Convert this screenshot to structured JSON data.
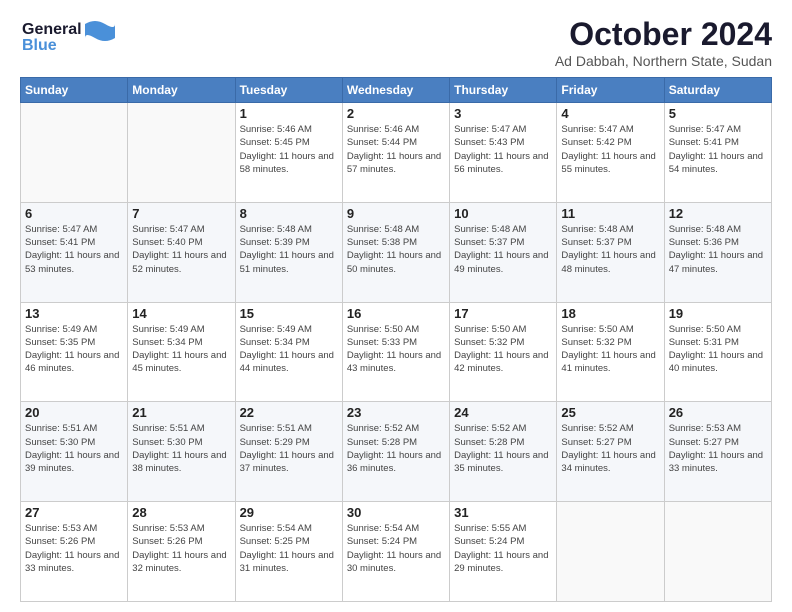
{
  "header": {
    "logo_line1": "General",
    "logo_line2": "Blue",
    "title": "October 2024",
    "subtitle": "Ad Dabbah, Northern State, Sudan"
  },
  "days_of_week": [
    "Sunday",
    "Monday",
    "Tuesday",
    "Wednesday",
    "Thursday",
    "Friday",
    "Saturday"
  ],
  "weeks": [
    [
      {
        "day": "",
        "info": ""
      },
      {
        "day": "",
        "info": ""
      },
      {
        "day": "1",
        "info": "Sunrise: 5:46 AM\nSunset: 5:45 PM\nDaylight: 11 hours and 58 minutes."
      },
      {
        "day": "2",
        "info": "Sunrise: 5:46 AM\nSunset: 5:44 PM\nDaylight: 11 hours and 57 minutes."
      },
      {
        "day": "3",
        "info": "Sunrise: 5:47 AM\nSunset: 5:43 PM\nDaylight: 11 hours and 56 minutes."
      },
      {
        "day": "4",
        "info": "Sunrise: 5:47 AM\nSunset: 5:42 PM\nDaylight: 11 hours and 55 minutes."
      },
      {
        "day": "5",
        "info": "Sunrise: 5:47 AM\nSunset: 5:41 PM\nDaylight: 11 hours and 54 minutes."
      }
    ],
    [
      {
        "day": "6",
        "info": "Sunrise: 5:47 AM\nSunset: 5:41 PM\nDaylight: 11 hours and 53 minutes."
      },
      {
        "day": "7",
        "info": "Sunrise: 5:47 AM\nSunset: 5:40 PM\nDaylight: 11 hours and 52 minutes."
      },
      {
        "day": "8",
        "info": "Sunrise: 5:48 AM\nSunset: 5:39 PM\nDaylight: 11 hours and 51 minutes."
      },
      {
        "day": "9",
        "info": "Sunrise: 5:48 AM\nSunset: 5:38 PM\nDaylight: 11 hours and 50 minutes."
      },
      {
        "day": "10",
        "info": "Sunrise: 5:48 AM\nSunset: 5:37 PM\nDaylight: 11 hours and 49 minutes."
      },
      {
        "day": "11",
        "info": "Sunrise: 5:48 AM\nSunset: 5:37 PM\nDaylight: 11 hours and 48 minutes."
      },
      {
        "day": "12",
        "info": "Sunrise: 5:48 AM\nSunset: 5:36 PM\nDaylight: 11 hours and 47 minutes."
      }
    ],
    [
      {
        "day": "13",
        "info": "Sunrise: 5:49 AM\nSunset: 5:35 PM\nDaylight: 11 hours and 46 minutes."
      },
      {
        "day": "14",
        "info": "Sunrise: 5:49 AM\nSunset: 5:34 PM\nDaylight: 11 hours and 45 minutes."
      },
      {
        "day": "15",
        "info": "Sunrise: 5:49 AM\nSunset: 5:34 PM\nDaylight: 11 hours and 44 minutes."
      },
      {
        "day": "16",
        "info": "Sunrise: 5:50 AM\nSunset: 5:33 PM\nDaylight: 11 hours and 43 minutes."
      },
      {
        "day": "17",
        "info": "Sunrise: 5:50 AM\nSunset: 5:32 PM\nDaylight: 11 hours and 42 minutes."
      },
      {
        "day": "18",
        "info": "Sunrise: 5:50 AM\nSunset: 5:32 PM\nDaylight: 11 hours and 41 minutes."
      },
      {
        "day": "19",
        "info": "Sunrise: 5:50 AM\nSunset: 5:31 PM\nDaylight: 11 hours and 40 minutes."
      }
    ],
    [
      {
        "day": "20",
        "info": "Sunrise: 5:51 AM\nSunset: 5:30 PM\nDaylight: 11 hours and 39 minutes."
      },
      {
        "day": "21",
        "info": "Sunrise: 5:51 AM\nSunset: 5:30 PM\nDaylight: 11 hours and 38 minutes."
      },
      {
        "day": "22",
        "info": "Sunrise: 5:51 AM\nSunset: 5:29 PM\nDaylight: 11 hours and 37 minutes."
      },
      {
        "day": "23",
        "info": "Sunrise: 5:52 AM\nSunset: 5:28 PM\nDaylight: 11 hours and 36 minutes."
      },
      {
        "day": "24",
        "info": "Sunrise: 5:52 AM\nSunset: 5:28 PM\nDaylight: 11 hours and 35 minutes."
      },
      {
        "day": "25",
        "info": "Sunrise: 5:52 AM\nSunset: 5:27 PM\nDaylight: 11 hours and 34 minutes."
      },
      {
        "day": "26",
        "info": "Sunrise: 5:53 AM\nSunset: 5:27 PM\nDaylight: 11 hours and 33 minutes."
      }
    ],
    [
      {
        "day": "27",
        "info": "Sunrise: 5:53 AM\nSunset: 5:26 PM\nDaylight: 11 hours and 33 minutes."
      },
      {
        "day": "28",
        "info": "Sunrise: 5:53 AM\nSunset: 5:26 PM\nDaylight: 11 hours and 32 minutes."
      },
      {
        "day": "29",
        "info": "Sunrise: 5:54 AM\nSunset: 5:25 PM\nDaylight: 11 hours and 31 minutes."
      },
      {
        "day": "30",
        "info": "Sunrise: 5:54 AM\nSunset: 5:24 PM\nDaylight: 11 hours and 30 minutes."
      },
      {
        "day": "31",
        "info": "Sunrise: 5:55 AM\nSunset: 5:24 PM\nDaylight: 11 hours and 29 minutes."
      },
      {
        "day": "",
        "info": ""
      },
      {
        "day": "",
        "info": ""
      }
    ]
  ]
}
